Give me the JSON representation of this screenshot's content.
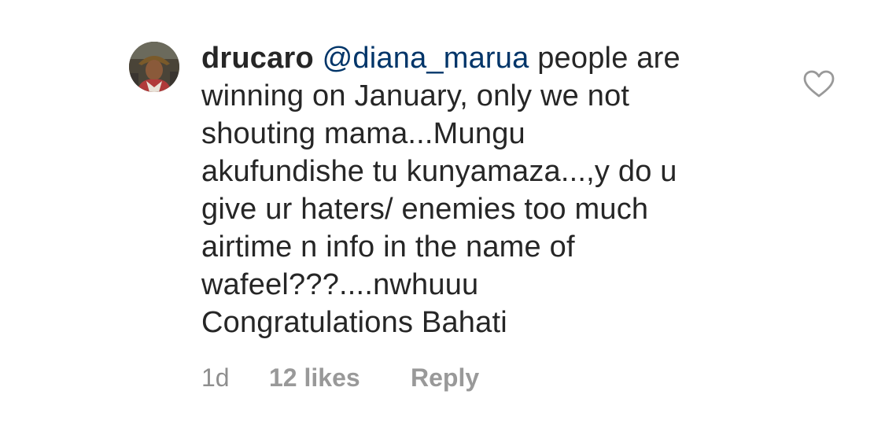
{
  "comment": {
    "username": "drucaro",
    "mention": "@diana_marua",
    "lines": [
      " people are",
      "winning on January, only we not",
      "shouting mama...Mungu",
      "akufundishe tu kunyamaza...,y do u",
      "give ur haters/ enemies too much",
      "airtime n info in the name of",
      "wafeel???....nwhuuu",
      "Congratulations  Bahati"
    ],
    "time": "1d",
    "likes": "12 likes",
    "reply_label": "Reply"
  },
  "icons": {
    "like": "heart-outline-icon",
    "avatar": "user-avatar"
  },
  "colors": {
    "text": "#262626",
    "mention": "#003569",
    "meta": "#8e8e8e",
    "heart_stroke": "#999999"
  }
}
